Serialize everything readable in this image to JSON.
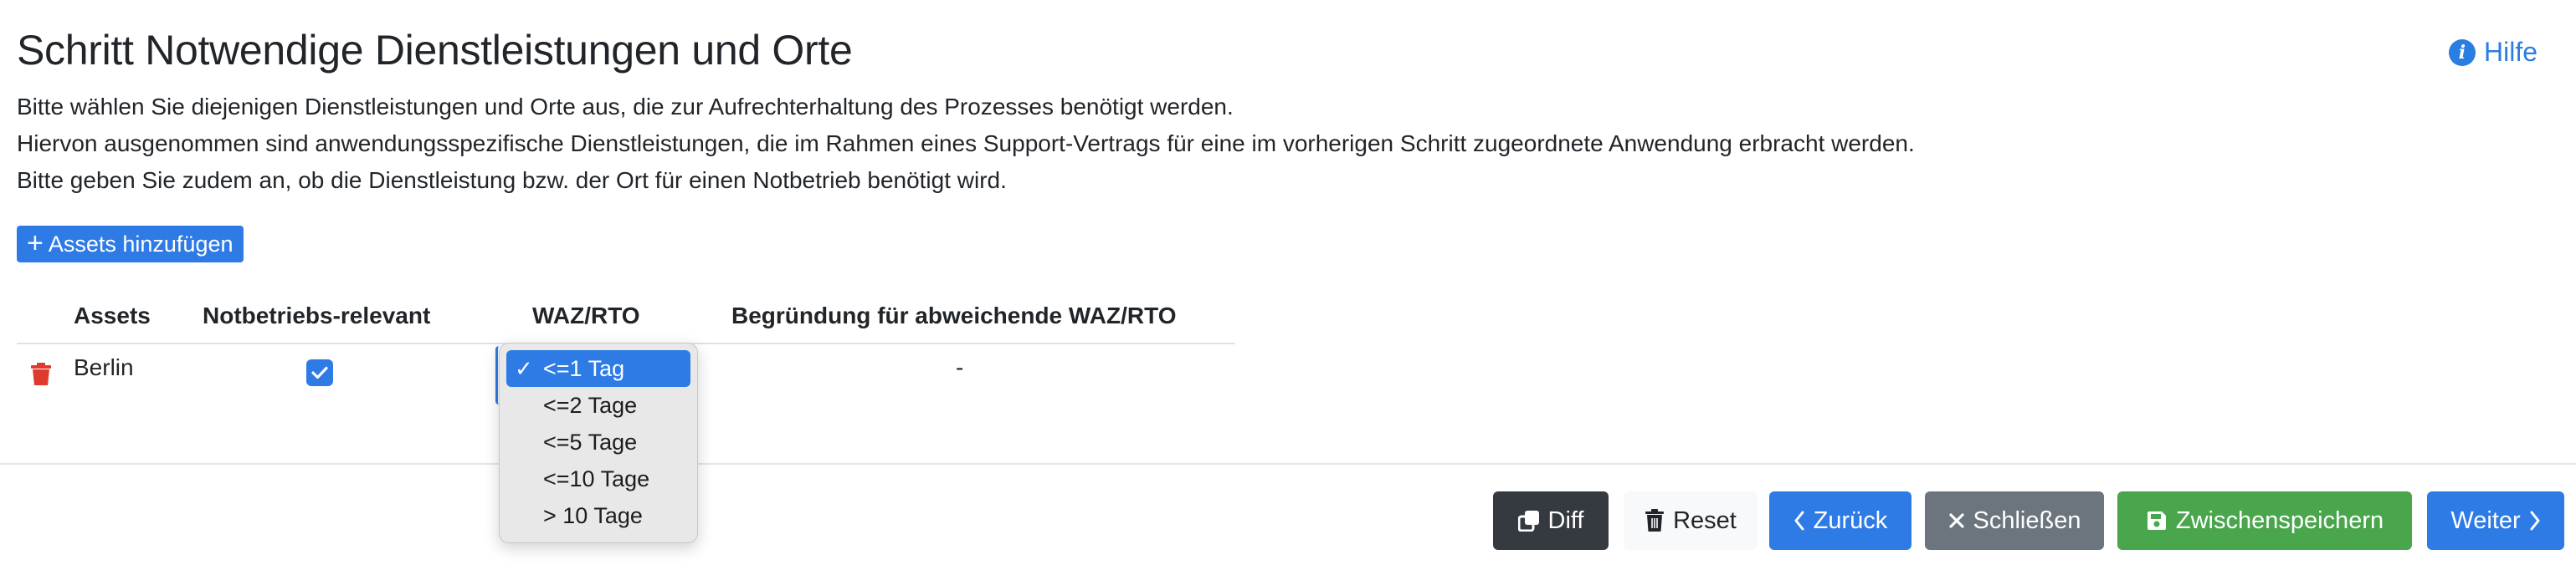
{
  "header": {
    "title": "Schritt Notwendige Dienstleistungen und Orte",
    "help_label": "Hilfe",
    "help_icon": "info-circle-icon"
  },
  "intro": {
    "line1": "Bitte wählen Sie diejenigen Dienstleistungen und Orte aus, die zur Aufrechterhaltung des Prozesses benötigt werden.",
    "line2": "Hiervon ausgenommen sind anwendungsspezifische Dienstleistungen, die im Rahmen eines Support-Vertrags für eine im vorherigen Schritt zugeordnete Anwendung erbracht werden.",
    "line3": "Bitte geben Sie zudem an, ob die Dienstleistung bzw. der Ort für einen Notbetrieb benötigt wird."
  },
  "add_button": {
    "label": "Assets hinzufügen",
    "icon": "plus-icon"
  },
  "table": {
    "columns": {
      "assets": "Assets",
      "emergency": "Notbetriebs-relevant",
      "waz": "WAZ/RTO",
      "reason": "Begründung für abweichende WAZ/RTO"
    },
    "rows": [
      {
        "asset": "Berlin",
        "emergency_relevant": true,
        "waz_rto": "<=1 Tag",
        "reason": "-"
      }
    ]
  },
  "waz_dropdown": {
    "options": [
      "<=1 Tag",
      "<=2 Tage",
      "<=5 Tage",
      "<=10 Tage",
      "> 10 Tage"
    ],
    "selected": "<=1 Tag",
    "check_mark": "✓"
  },
  "footer": {
    "diff_label": "Diff",
    "reset_label": "Reset",
    "back_label": "Zurück",
    "close_label": "Schließen",
    "save_label": "Zwischenspeichern",
    "next_label": "Weiter"
  },
  "colors": {
    "primary": "#2e7be6",
    "dark": "#343a40",
    "secondary": "#6c757d",
    "success": "#4aa64c",
    "danger": "#e03a2f",
    "light": "#f8f9fa"
  }
}
